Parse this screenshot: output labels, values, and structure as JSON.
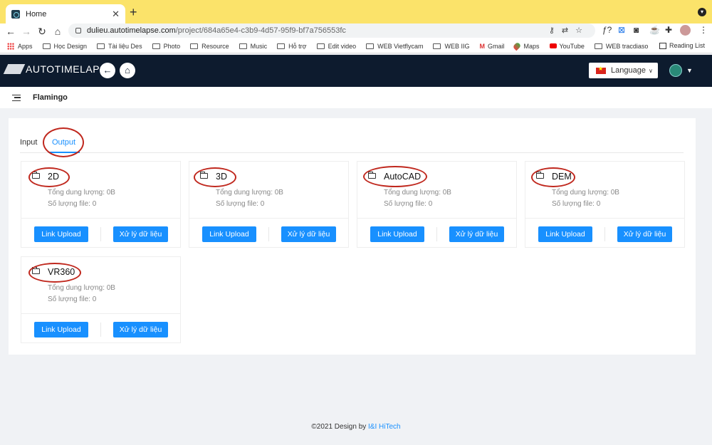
{
  "browser": {
    "tab_title": "Home",
    "url_host": "dulieu.autotimelapse.com",
    "url_path": "/project/684a65e4-c3b9-4d57-95f9-bf7a756553fc",
    "bookmarks": [
      "Apps",
      "Học Design",
      "Tài liệu Des",
      "Photo",
      "Resource",
      "Music",
      "Hỗ trợ",
      "Edit video",
      "WEB Vietflycam",
      "WEB IIG",
      "Gmail",
      "Maps",
      "YouTube",
      "WEB tracdiaso"
    ],
    "reading_list": "Reading List"
  },
  "header": {
    "logo": "AUTOTIMELAPSE",
    "language_label": "Language"
  },
  "subheader": {
    "title": "Flamingo"
  },
  "tabs": {
    "input": "Input",
    "output": "Output",
    "active": "Output"
  },
  "folders": [
    {
      "name": "2D",
      "size_label": "Tổng dung lượng: 0B",
      "files_label": "Số lượng file: 0",
      "upload": "Link Upload",
      "process": "Xử lý dữ liệu"
    },
    {
      "name": "3D",
      "size_label": "Tổng dung lượng: 0B",
      "files_label": "Số lượng file: 0",
      "upload": "Link Upload",
      "process": "Xử lý dữ liệu"
    },
    {
      "name": "AutoCAD",
      "size_label": "Tổng dung lượng: 0B",
      "files_label": "Số lượng file: 0",
      "upload": "Link Upload",
      "process": "Xử lý dữ liệu"
    },
    {
      "name": "DEM",
      "size_label": "Tổng dung lượng: 0B",
      "files_label": "Số lượng file: 0",
      "upload": "Link Upload",
      "process": "Xử lý dữ liệu"
    },
    {
      "name": "VR360",
      "size_label": "Tổng dung lượng: 0B",
      "files_label": "Số lượng file: 0",
      "upload": "Link Upload",
      "process": "Xử lý dữ liệu"
    }
  ],
  "footer": {
    "text": "©2021 Design by ",
    "brand": "I&I HiTech"
  },
  "colors": {
    "primary": "#1890ff",
    "header_bg": "#0d1b2e",
    "annotation": "#c0281e",
    "tabstrip": "#fbe36a"
  }
}
